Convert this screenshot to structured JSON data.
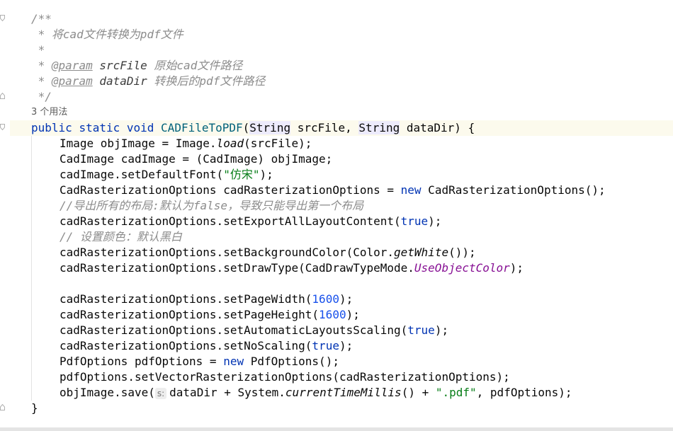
{
  "editor": {
    "javadoc": {
      "open": "/**",
      "star": " * ",
      "star_only": " *",
      "summary": "将cad文件转换为pdf文件",
      "param_tag": "@param",
      "param1_name": "srcFile",
      "param1_desc": "原始cad文件路径",
      "param2_name": "dataDir",
      "param2_desc": "转换后的pdf文件路径",
      "close": " */"
    },
    "usage_hint": "3 个用法",
    "signature": {
      "public": "public",
      "static": "static",
      "void": "void",
      "name": "CADFileToPDF",
      "type1": "String",
      "arg1": "srcFile",
      "type2": "String",
      "arg2": "dataDir",
      "open_brace": "{"
    },
    "body": {
      "l1_a": "Image objImage = Image.",
      "l1_call": "load",
      "l1_b": "(srcFile);",
      "l2": "CadImage cadImage = (CadImage) objImage;",
      "l3_a": "cadImage.setDefaultFont(",
      "l3_str": "\"仿宋\"",
      "l3_b": ");",
      "l4_a": "CadRasterizationOptions cadRasterizationOptions = ",
      "l4_new": "new",
      "l4_b": " CadRasterizationOptions();",
      "c1": "//导出所有的布局:默认为false，导致只能导出第一个布局",
      "l5_a": "cadRasterizationOptions.setExportAllLayoutContent(",
      "l5_true": "true",
      "l5_b": ");",
      "c2": "// 设置颜色：默认黑白",
      "l6_a": "cadRasterizationOptions.setBackgroundColor(Color.",
      "l6_call": "getWhite",
      "l6_b": "());",
      "l7_a": "cadRasterizationOptions.setDrawType(CadDrawTypeMode.",
      "l7_field": "UseObjectColor",
      "l7_b": ");",
      "l8_a": "cadRasterizationOptions.setPageWidth(",
      "l8_num": "1600",
      "l8_b": ");",
      "l9_a": "cadRasterizationOptions.setPageHeight(",
      "l9_num": "1600",
      "l9_b": ");",
      "l10_a": "cadRasterizationOptions.setAutomaticLayoutsScaling(",
      "l10_true": "true",
      "l10_b": ");",
      "l11_a": "cadRasterizationOptions.setNoScaling(",
      "l11_true": "true",
      "l11_b": ");",
      "l12_a": "PdfOptions pdfOptions = ",
      "l12_new": "new",
      "l12_b": " PdfOptions();",
      "l13": "pdfOptions.setVectorRasterizationOptions(cadRasterizationOptions);",
      "l14_a": "objImage.save(",
      "l14_hint": "s:",
      "l14_b": "dataDir + System.",
      "l14_call": "currentTimeMillis",
      "l14_c": "() + ",
      "l14_str": "\".pdf\"",
      "l14_d": ", pdfOptions);",
      "close_brace": "}"
    }
  },
  "colors": {
    "keyword": "#0033b3",
    "method_decl": "#00627a",
    "string": "#067d17",
    "number": "#1750eb",
    "comment": "#8c8c8c",
    "static_field": "#871094",
    "current_line": "#fcfaed"
  },
  "icons": [
    "fold-open-icon",
    "fold-close-icon"
  ]
}
